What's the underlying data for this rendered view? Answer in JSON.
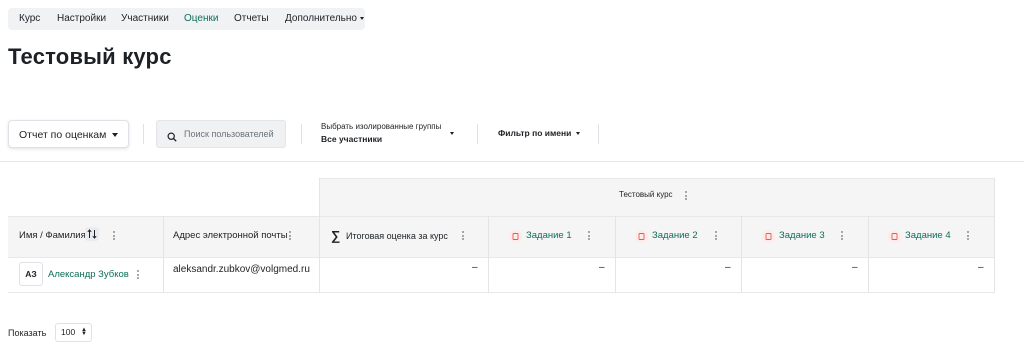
{
  "tabs": [
    {
      "label": "Курс"
    },
    {
      "label": "Настройки"
    },
    {
      "label": "Участники"
    },
    {
      "label": "Оценки",
      "active": true
    },
    {
      "label": "Отчеты"
    },
    {
      "label": "Дополнительно"
    }
  ],
  "page_title": "Тестовый курс",
  "toolbar": {
    "report_select": "Отчет по оценкам",
    "search_placeholder": "Поиск пользователей",
    "group_label": "Выбрать изолированные группы",
    "group_value": "Все участники",
    "name_filter": "Фильтр по имени"
  },
  "table": {
    "course_header": "Тестовый курс",
    "col_name": "Имя / Фамилия",
    "col_email": "Адрес электронной почты",
    "col_total": "Итоговая оценка за курс",
    "assignments": [
      "Задание 1",
      "Задание 2",
      "Задание 3",
      "Задание 4"
    ],
    "rows": [
      {
        "initials": "АЗ",
        "name": "Александр Зубков",
        "email": "aleksandr.zubkov@volgmed.ru",
        "grades": [
          "–",
          "–",
          "–",
          "–",
          "–"
        ]
      }
    ]
  },
  "footer": {
    "show_label": "Показать",
    "per_page": "100"
  },
  "colors": {
    "accent": "#0f6e5a",
    "header_bg": "#f5f5f5",
    "tab_bg": "#f1f2f3"
  },
  "icons": [
    "search-icon",
    "sort-icon",
    "kebab-icon",
    "sigma-icon",
    "assignment-icon",
    "caret-down-icon"
  ]
}
